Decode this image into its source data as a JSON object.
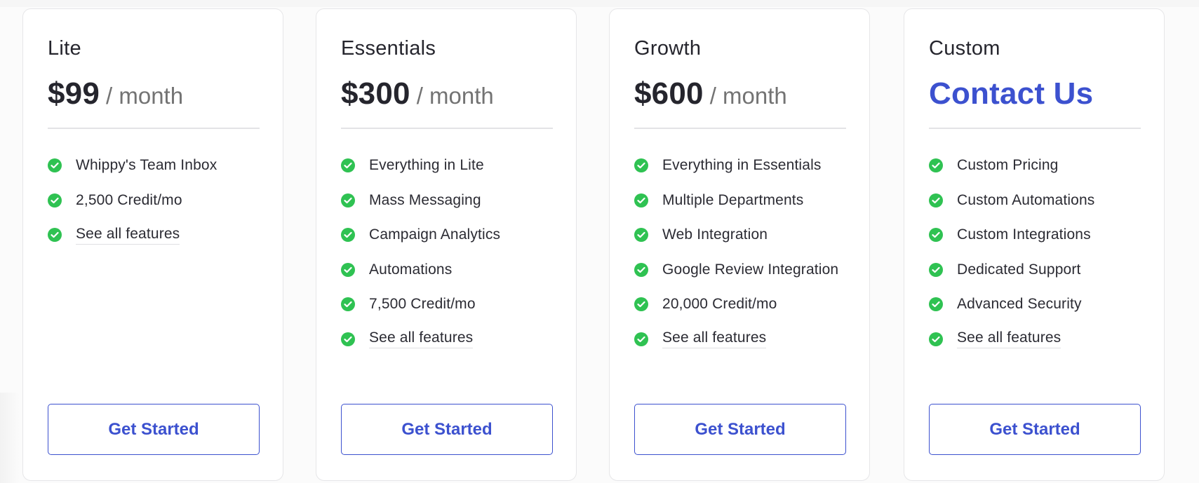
{
  "colors": {
    "accent": "#3c51cf",
    "check": "#2fc252",
    "text": "#25252d",
    "muted": "#737373",
    "border": "#e6e6e8"
  },
  "plans": [
    {
      "name": "Lite",
      "price": "$99",
      "period": "/ month",
      "features": [
        "Whippy's Team Inbox",
        "2,500 Credit/mo"
      ],
      "see_all_label": "See all features",
      "cta_label": "Get Started"
    },
    {
      "name": "Essentials",
      "price": "$300",
      "period": "/ month",
      "features": [
        "Everything in Lite",
        "Mass Messaging",
        "Campaign Analytics",
        "Automations",
        "7,500 Credit/mo"
      ],
      "see_all_label": "See all features",
      "cta_label": "Get Started"
    },
    {
      "name": "Growth",
      "price": "$600",
      "period": "/ month",
      "features": [
        "Everything in Essentials",
        "Multiple Departments",
        "Web Integration",
        "Google Review Integration",
        "20,000 Credit/mo"
      ],
      "see_all_label": "See all features",
      "cta_label": "Get Started"
    },
    {
      "name": "Custom",
      "price_contact": "Contact Us",
      "features": [
        "Custom Pricing",
        "Custom Automations",
        "Custom Integrations",
        "Dedicated Support",
        "Advanced Security"
      ],
      "see_all_label": "See all features",
      "cta_label": "Get Started"
    }
  ],
  "icons": {
    "feature_check": "check-circle-icon"
  }
}
